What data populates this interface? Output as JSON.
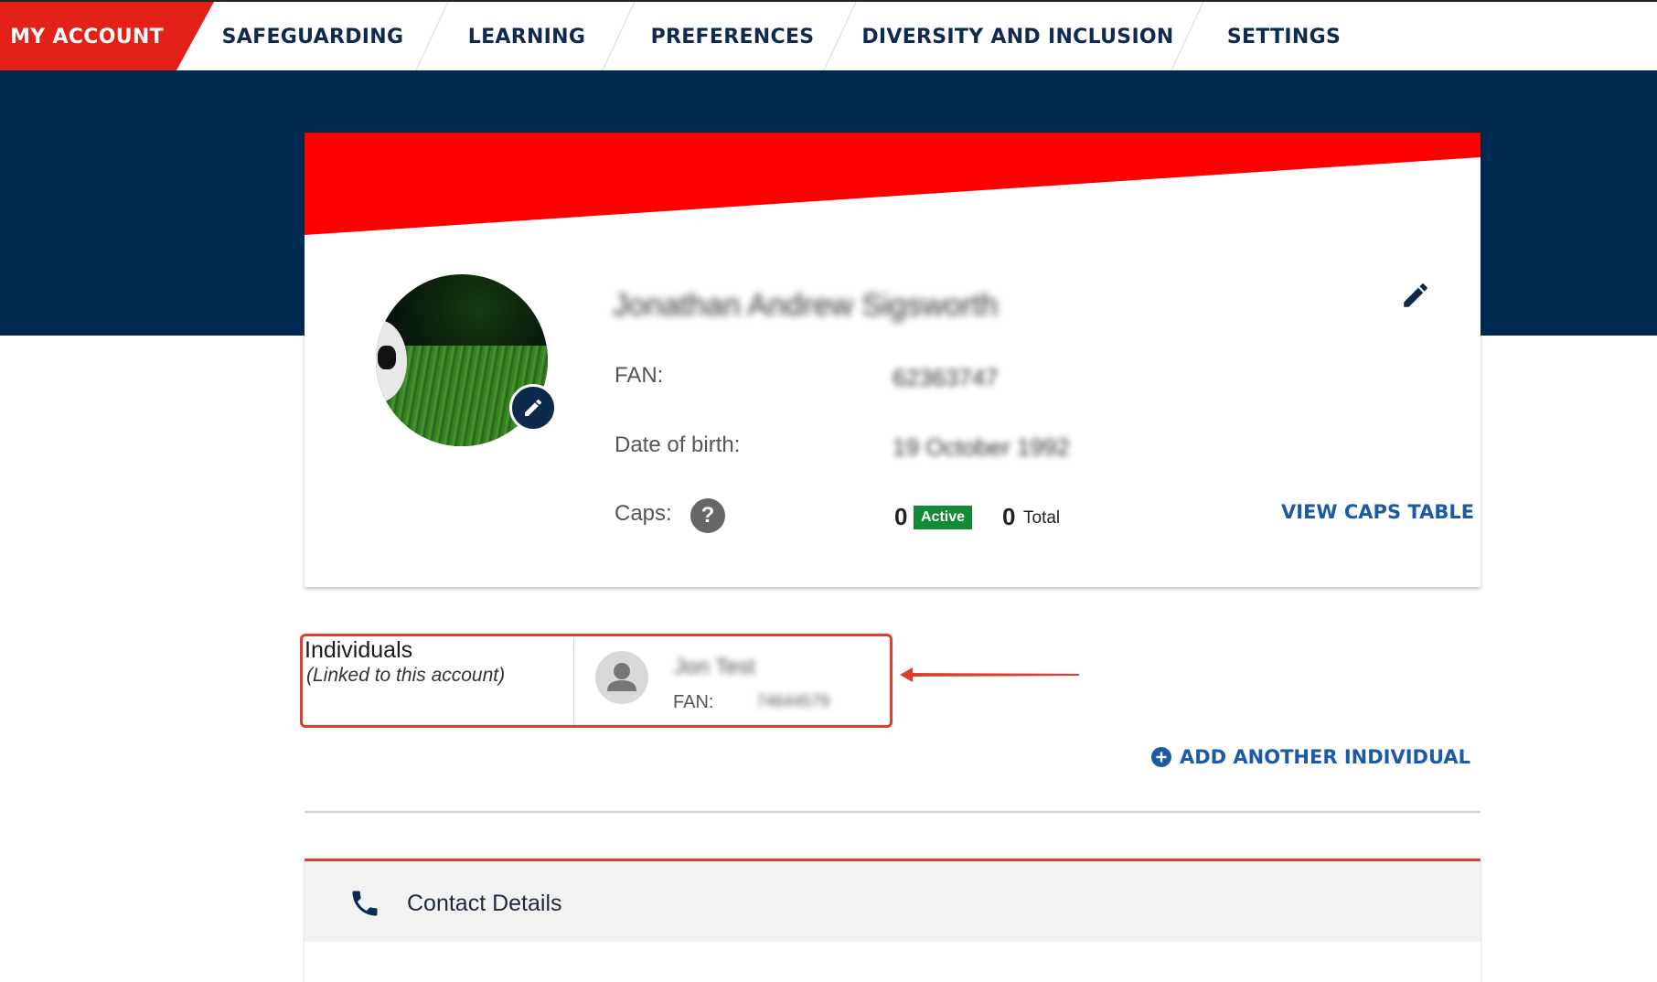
{
  "nav": {
    "items": [
      {
        "label": "MY ACCOUNT",
        "active": true
      },
      {
        "label": "SAFEGUARDING"
      },
      {
        "label": "LEARNING"
      },
      {
        "label": "PREFERENCES"
      },
      {
        "label": "DIVERSITY AND INCLUSION"
      },
      {
        "label": "SETTINGS"
      }
    ]
  },
  "colors": {
    "brand_red": "#e32119",
    "navy": "#002a52",
    "link_blue": "#1a5aa6",
    "active_green": "#138a36"
  },
  "profile": {
    "name": "Jonathan Andrew Sigsworth",
    "fan_label": "FAN:",
    "fan_value": "62363747",
    "dob_label": "Date of birth:",
    "dob_value": "19 October 1992",
    "caps_label": "Caps:",
    "help_glyph": "?",
    "caps_active_count": "0",
    "caps_active_badge": "Active",
    "caps_total_count": "0",
    "caps_total_label": "Total",
    "view_caps_link": "VIEW CAPS TABLE",
    "edit_icon": "pencil-icon",
    "avatar_edit_icon": "pencil-icon"
  },
  "individuals": {
    "title": "Individuals",
    "subtitle": "(Linked to this account)",
    "person": {
      "name": "Jon Test",
      "fan_label": "FAN:",
      "fan_value": "74644579"
    },
    "add_link": "ADD ANOTHER INDIVIDUAL",
    "add_icon": "plus-circle-icon"
  },
  "contact": {
    "title": "Contact Details",
    "icon": "phone-icon"
  }
}
